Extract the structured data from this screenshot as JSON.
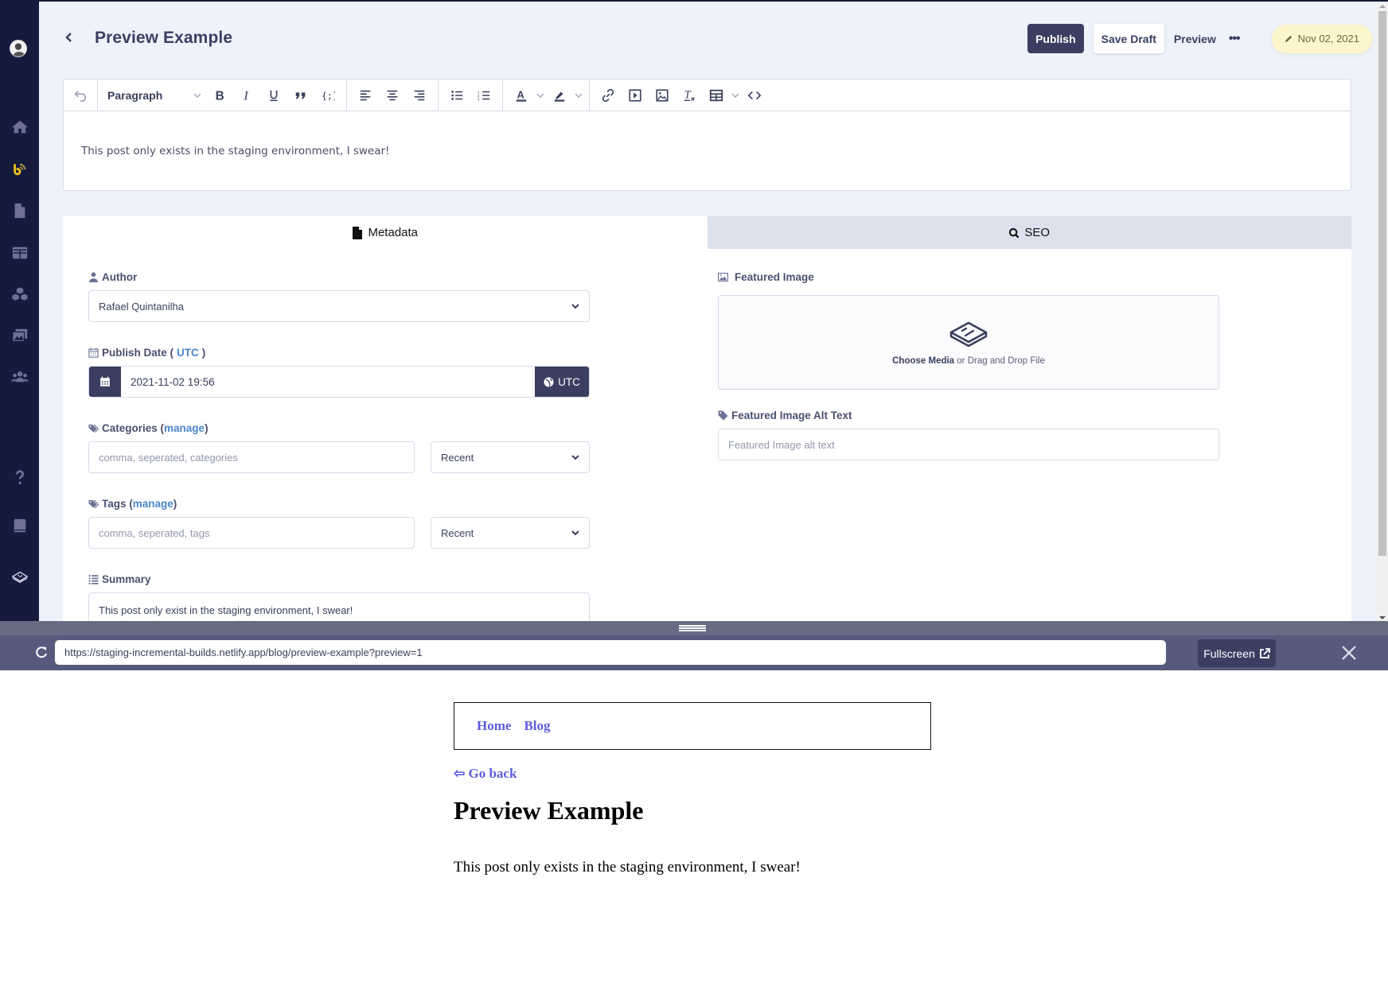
{
  "sidebar": {
    "items": [
      {
        "name": "home",
        "icon": "home-icon"
      },
      {
        "name": "blog",
        "icon": "blog-rss-icon",
        "active": true
      },
      {
        "name": "pages",
        "icon": "file-icon"
      },
      {
        "name": "tables",
        "icon": "table-icon"
      },
      {
        "name": "components",
        "icon": "cubes-icon"
      },
      {
        "name": "media",
        "icon": "images-icon"
      },
      {
        "name": "users",
        "icon": "users-icon"
      },
      {
        "name": "help",
        "icon": "question-icon"
      },
      {
        "name": "docs",
        "icon": "book-icon"
      },
      {
        "name": "brand",
        "icon": "logo-icon"
      }
    ],
    "active_color": "#f5c518"
  },
  "header": {
    "back_icon": "chevron-left-icon",
    "title": "Preview Example",
    "publish_label": "Publish",
    "save_draft_label": "Save Draft",
    "preview_label": "Preview",
    "more_label": "•••",
    "date_badge": "Nov 02, 2021",
    "date_badge_icon": "pencil-icon"
  },
  "editor": {
    "block_format": "Paragraph",
    "toolbar": [
      "undo",
      "bold",
      "italic",
      "underline",
      "blockquote",
      "code",
      "align-left",
      "align-center",
      "align-right",
      "bullet-list",
      "numbered-list",
      "text-color",
      "highlight",
      "link",
      "video",
      "image",
      "clear-format",
      "table",
      "source-code"
    ],
    "content": "This post only exists in the staging environment, I swear!"
  },
  "tabs": [
    {
      "label": "Metadata",
      "icon": "file-icon",
      "active": true
    },
    {
      "label": "SEO",
      "icon": "search-icon",
      "active": false
    }
  ],
  "metadata": {
    "author_label": "Author",
    "author_value": "Rafael Quintanilha",
    "publish_date_label": "Publish Date (",
    "publish_date_tz": "UTC",
    "publish_date_close": ")",
    "publish_date_value": "2021-11-02 19:56",
    "publish_date_tz_button": "UTC",
    "categories_label": "Categories (",
    "categories_manage": "manage",
    "categories_close": ")",
    "categories_placeholder": "comma, seperated, categories",
    "categories_filter": "Recent",
    "tags_label": "Tags (",
    "tags_manage": "manage",
    "tags_close": ")",
    "tags_placeholder": "comma, seperated, tags",
    "tags_filter": "Recent",
    "summary_label": "Summary",
    "summary_value": "This post only exist in the staging environment, I swear!",
    "featured_image_label": "Featured Image",
    "choose_media": "Choose Media",
    "drop_text": " or Drag and Drop File",
    "alt_text_label": "Featured Image Alt Text",
    "alt_text_placeholder": "Featured Image alt text"
  },
  "preview": {
    "url": "https://staging-incremental-builds.netlify.app/blog/preview-example?preview=1",
    "fullscreen_label": "Fullscreen",
    "site": {
      "nav": [
        "Home",
        "Blog"
      ],
      "go_back": "⇦ Go back",
      "title": "Preview Example",
      "body": "This post only exists in the staging environment, I swear!"
    }
  }
}
